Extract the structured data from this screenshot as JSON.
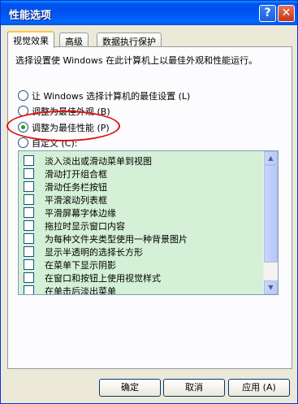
{
  "window": {
    "title": "性能选项"
  },
  "tabs": [
    {
      "label": "视觉效果"
    },
    {
      "label": "高级"
    },
    {
      "label": "数据执行保护"
    }
  ],
  "intro": "选择设置使 Windows 在此计算机上以最佳外观和性能运行。",
  "radios": [
    {
      "label": "让 Windows 选择计算机的最佳设置 (L)",
      "selected": false
    },
    {
      "label": "调整为最佳外观 (B)",
      "selected": false
    },
    {
      "label": "调整为最佳性能 (P)",
      "selected": true
    },
    {
      "label": "自定义 (C):",
      "selected": false
    }
  ],
  "effects": [
    {
      "label": "淡入淡出或滑动菜单到视图",
      "checked": false
    },
    {
      "label": "滑动打开组合框",
      "checked": false
    },
    {
      "label": "滑动任务栏按钮",
      "checked": false
    },
    {
      "label": "平滑滚动列表框",
      "checked": false
    },
    {
      "label": "平滑屏幕字体边缘",
      "checked": false
    },
    {
      "label": "拖拉时显示窗口内容",
      "checked": false
    },
    {
      "label": "为每种文件夹类型使用一种背景图片",
      "checked": false
    },
    {
      "label": "显示半透明的选择长方形",
      "checked": false
    },
    {
      "label": "在菜单下显示阴影",
      "checked": false
    },
    {
      "label": "在窗口和按钮上使用视觉样式",
      "checked": false
    },
    {
      "label": "在单击后淡出菜单",
      "checked": false
    }
  ],
  "buttons": {
    "ok": "确定",
    "cancel": "取消",
    "apply": "应用 (A)"
  },
  "colors": {
    "list_bg": "#d4f0d6",
    "highlight": "#e01010",
    "title_bar": "#0053ee"
  }
}
